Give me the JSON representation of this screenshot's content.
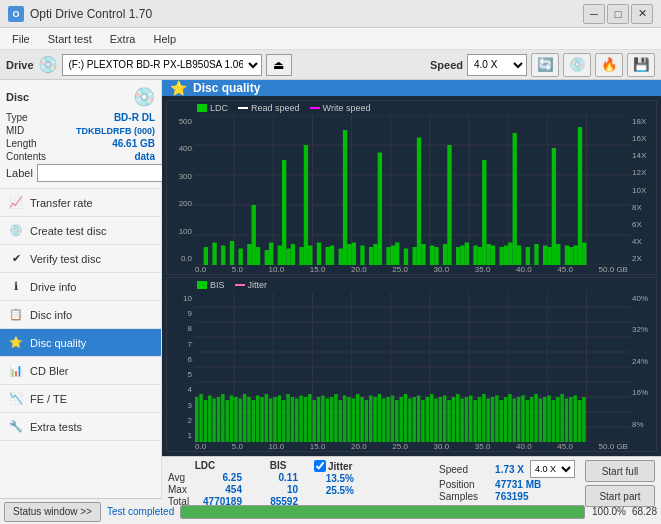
{
  "titlebar": {
    "title": "Opti Drive Control 1.70",
    "icon": "O",
    "minimize": "─",
    "maximize": "□",
    "close": "✕"
  },
  "menubar": {
    "items": [
      "File",
      "Start test",
      "Extra",
      "Help"
    ]
  },
  "drive": {
    "label": "Drive",
    "value": "(F:) PLEXTOR BD-R  PX-LB950SA 1.06",
    "speed_label": "Speed",
    "speed_value": "4.0 X"
  },
  "disc": {
    "title": "Disc",
    "type_label": "Type",
    "type_value": "BD-R DL",
    "mid_label": "MID",
    "mid_value": "TDKBLDRFB (000)",
    "length_label": "Length",
    "length_value": "46.61 GB",
    "contents_label": "Contents",
    "contents_value": "data",
    "label_label": "Label",
    "label_value": ""
  },
  "nav": {
    "items": [
      {
        "id": "transfer-rate",
        "label": "Transfer rate",
        "icon": "📈"
      },
      {
        "id": "create-test-disc",
        "label": "Create test disc",
        "icon": "💿"
      },
      {
        "id": "verify-test-disc",
        "label": "Verify test disc",
        "icon": "✔"
      },
      {
        "id": "drive-info",
        "label": "Drive info",
        "icon": "ℹ"
      },
      {
        "id": "disc-info",
        "label": "Disc info",
        "icon": "📋"
      },
      {
        "id": "disc-quality",
        "label": "Disc quality",
        "icon": "⭐",
        "active": true
      },
      {
        "id": "cd-bler",
        "label": "CD Bler",
        "icon": "📊"
      },
      {
        "id": "fe-te",
        "label": "FE / TE",
        "icon": "📉"
      },
      {
        "id": "extra-tests",
        "label": "Extra tests",
        "icon": "🔧"
      }
    ]
  },
  "chart": {
    "title": "Disc quality",
    "icon": "⭐",
    "top": {
      "legend": [
        {
          "id": "ldc",
          "label": "LDC",
          "color": "#00cc00"
        },
        {
          "id": "read-speed",
          "label": "Read speed",
          "color": "#ffffff"
        },
        {
          "id": "write-speed",
          "label": "Write speed",
          "color": "#ff00ff"
        }
      ],
      "y_max": 500,
      "y_labels_left": [
        "500",
        "400",
        "300",
        "200",
        "100",
        "0.0"
      ],
      "y_labels_right": [
        "18X",
        "16X",
        "14X",
        "12X",
        "10X",
        "8X",
        "6X",
        "4X",
        "2X"
      ],
      "x_labels": [
        "0.0",
        "5.0",
        "10.0",
        "15.0",
        "20.0",
        "25.0",
        "30.0",
        "35.0",
        "40.0",
        "45.0",
        "50.0 GB"
      ]
    },
    "bottom": {
      "legend": [
        {
          "id": "bis",
          "label": "BIS",
          "color": "#00cc00"
        },
        {
          "id": "jitter",
          "label": "Jitter",
          "color": "#ff69b4"
        }
      ],
      "y_max": 10,
      "y_labels_left": [
        "10",
        "9",
        "8",
        "7",
        "6",
        "5",
        "4",
        "3",
        "2",
        "1"
      ],
      "y_labels_right": [
        "40%",
        "32%",
        "24%",
        "16%",
        "8%"
      ],
      "x_labels": [
        "0.0",
        "5.0",
        "10.0",
        "15.0",
        "20.0",
        "25.0",
        "30.0",
        "35.0",
        "40.0",
        "45.0",
        "50.0 GB"
      ]
    }
  },
  "stats": {
    "columns": [
      {
        "header": "LDC",
        "rows": [
          {
            "label": "Avg",
            "value": "6.25"
          },
          {
            "label": "Max",
            "value": "454"
          },
          {
            "label": "Total",
            "value": "4770189"
          }
        ]
      },
      {
        "header": "BIS",
        "rows": [
          {
            "label": "Avg",
            "value": "0.11"
          },
          {
            "label": "Max",
            "value": "10"
          },
          {
            "label": "Total",
            "value": "85592"
          }
        ]
      },
      {
        "header": "Jitter",
        "rows": [
          {
            "label": "Avg",
            "value": "13.5%"
          },
          {
            "label": "Max",
            "value": "25.5%"
          },
          {
            "label": "Total",
            "value": ""
          }
        ]
      }
    ],
    "jitter_checked": true,
    "jitter_label": "Jitter",
    "speed_label": "Speed",
    "speed_value": "1.73 X",
    "speed_dropdown": "4.0 X",
    "position_label": "Position",
    "position_value": "47731 MB",
    "samples_label": "Samples",
    "samples_value": "763195",
    "start_full_label": "Start full",
    "start_part_label": "Start part"
  },
  "statusbar": {
    "window_btn": "Status window >>",
    "status_text": "Test completed",
    "progress_pct": "100.0%",
    "value": "68.28"
  }
}
